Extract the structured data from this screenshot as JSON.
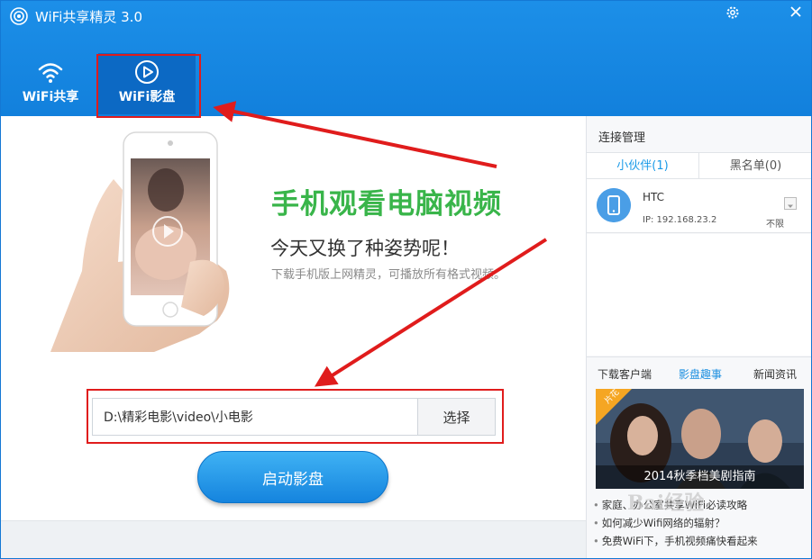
{
  "app": {
    "title": "WiFi共享精灵 3.0",
    "accent_color": "#1585e0",
    "annotation_color": "#e01c1c"
  },
  "window_controls": {
    "settings_icon": "gear-icon",
    "close_icon": "close-icon"
  },
  "tabs": [
    {
      "label": "WiFi共享",
      "icon": "wifi-icon",
      "active": false
    },
    {
      "label": "WiFi影盘",
      "icon": "play-circle-icon",
      "active": true
    }
  ],
  "hero": {
    "title": "手机观看电脑视频",
    "subtitle": "今天又换了种姿势呢！",
    "description": "下载手机版上网精灵，可播放所有格式视频。"
  },
  "path_selector": {
    "value": "D:\\精彩电影\\video\\小电影",
    "choose_label": "选择"
  },
  "start_button": {
    "label": "启动影盘"
  },
  "connection_panel": {
    "title": "连接管理",
    "tabs": [
      "小伙伴(1)",
      "黑名单(0)"
    ],
    "devices": [
      {
        "name": "HTC",
        "ip": "IP: 192.168.23.2",
        "limit": "不限"
      }
    ]
  },
  "news": {
    "tabs": [
      "下载客户端",
      "影盘趣事",
      "新闻资讯"
    ],
    "active_tab": "影盘趣事",
    "banner_tag": "片花",
    "banner_caption": "2014秋季档美剧指南",
    "items": [
      "家庭、办公室共享WiFi必读攻略",
      "如何减少Wifi网络的辐射？",
      "免费WiFi下，手机视频痛快看起来"
    ]
  },
  "watermark": "Bai经验"
}
